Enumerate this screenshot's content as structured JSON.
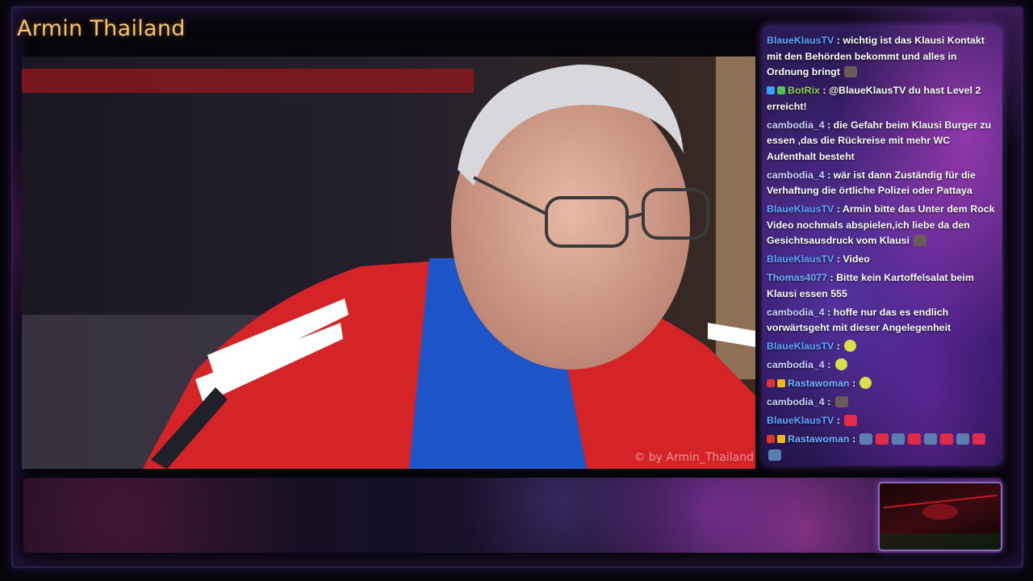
{
  "channel": {
    "title": "Armin Thailand"
  },
  "video": {
    "watermark": "© by Armin_Thailand"
  },
  "chat": {
    "messages": [
      {
        "user": "BlaueKlausTV",
        "text": "wichtig ist das Klausi Kontakt mit den Behörden bekommt und alles in Ordnung bringt",
        "emotes": [
          "klausi-emote"
        ]
      },
      {
        "user": "BotRix",
        "text": "@BlaueKlausTV du hast Level 2 erreicht!",
        "badges": [
          "bot-badge",
          "verified-badge"
        ]
      },
      {
        "user": "cambodia_4",
        "text": "die Gefahr beim Klausi Burger zu essen ,das die Rückreise mit mehr WC Aufenthalt besteht"
      },
      {
        "user": "cambodia_4",
        "text": "wär ist dann Zuständig für die Verhaftung die örtliche Polizei oder Pattaya"
      },
      {
        "user": "BlaueKlausTV",
        "text": "Armin bitte das Unter dem Rock Video nochmals abspielen,ich liebe da den Gesichtsausdruck vom Klausi",
        "emotes": [
          "klausi-emote"
        ]
      },
      {
        "user": "BlaueKlausTV",
        "text": "Video"
      },
      {
        "user": "Thomas4077",
        "text": "Bitte kein Kartoffelsalat beim Klausi essen 555"
      },
      {
        "user": "cambodia_4",
        "text": "hoffe nur das es endlich vorwärtsgeht mit dieser Angelegenheit"
      },
      {
        "user": "BlaueKlausTV",
        "text": "",
        "emotes": [
          "smile-emote"
        ]
      },
      {
        "user": "cambodia_4",
        "text": "",
        "emotes": [
          "smile-emote"
        ]
      },
      {
        "user": "Rastawoman",
        "text": "",
        "badges": [
          "flag-badge",
          "sub-badge"
        ],
        "emotes": [
          "smile-emote"
        ]
      },
      {
        "user": "cambodia_4",
        "text": "",
        "emotes": [
          "klausi-emote"
        ]
      },
      {
        "user": "BlaueKlausTV",
        "text": "",
        "emotes": [
          "red-emote"
        ]
      },
      {
        "user": "Rastawoman",
        "text": "",
        "badges": [
          "flag-badge",
          "sub-badge"
        ],
        "emotes": [
          "cat-emote",
          "red-emote",
          "cat-emote",
          "red-emote",
          "cat-emote",
          "red-emote",
          "cat-emote",
          "red-emote",
          "cat-emote"
        ]
      }
    ]
  },
  "colors": {
    "title": "#f3c46a",
    "username": "#5aa6ff",
    "bot": "#8fd14f"
  }
}
